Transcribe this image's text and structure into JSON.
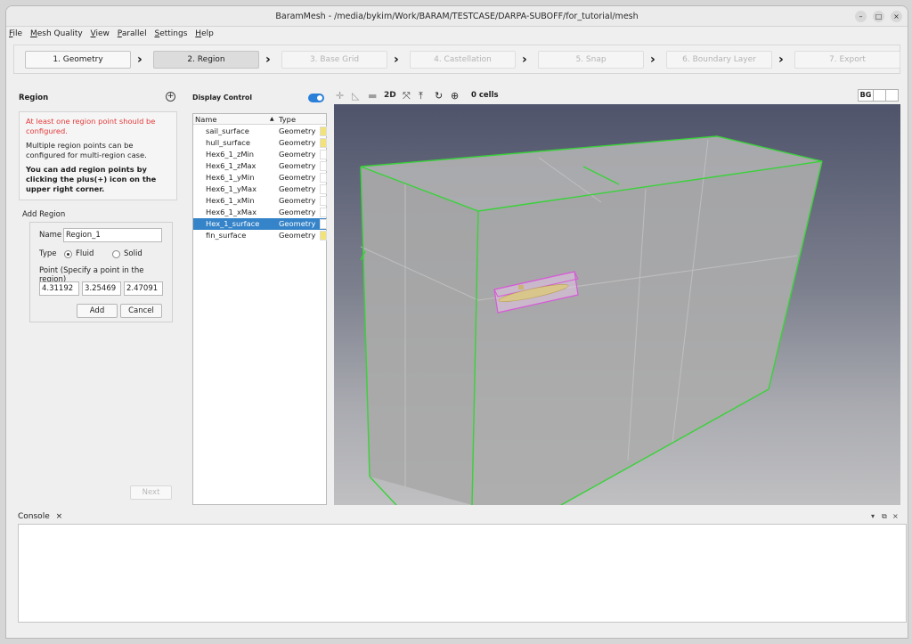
{
  "window": {
    "title": "BaramMesh - /media/bykim/Work/BARAM/TESTCASE/DARPA-SUBOFF/for_tutorial/mesh",
    "controls": [
      "–",
      "□",
      "×"
    ]
  },
  "menu": [
    "File",
    "Mesh Quality",
    "View",
    "Parallel",
    "Settings",
    "Help"
  ],
  "steps": [
    {
      "label": "1. Geometry",
      "state": "enabled"
    },
    {
      "label": "2. Region",
      "state": "active"
    },
    {
      "label": "3. Base Grid",
      "state": "disabled"
    },
    {
      "label": "4. Castellation",
      "state": "disabled"
    },
    {
      "label": "5. Snap",
      "state": "disabled"
    },
    {
      "label": "6. Boundary Layer",
      "state": "disabled"
    },
    {
      "label": "7. Export",
      "state": "disabled"
    }
  ],
  "region_panel": {
    "title": "Region",
    "add_icon": "plus-circle-icon",
    "error": "At least one region point should be configured.",
    "info": "Multiple region points can be configured for multi-region case.",
    "hint": "You can add region points by clicking the plus(+) icon on the upper right corner.",
    "add_region_label": "Add Region",
    "name_label": "Name",
    "name_value": "Region_1",
    "type_label": "Type",
    "type_options": [
      "Fluid",
      "Solid"
    ],
    "type_selected": "Fluid",
    "point_label": "Point (Specify a point in the region)",
    "point": [
      "4.31192",
      "3.25469",
      "2.47091"
    ],
    "add_button": "Add",
    "cancel_button": "Cancel",
    "next_button": "Next"
  },
  "display_control": {
    "title": "Display Control",
    "columns": [
      "Name",
      "Type"
    ],
    "rows": [
      {
        "name": "sail_surface",
        "type": "Geometry",
        "color": "#f2e27a"
      },
      {
        "name": "hull_surface",
        "type": "Geometry",
        "color": "#f2e27a"
      },
      {
        "name": "Hex6_1_zMin",
        "type": "Geometry",
        "color": "#ffffff"
      },
      {
        "name": "Hex6_1_zMax",
        "type": "Geometry",
        "color": "#ffffff"
      },
      {
        "name": "Hex6_1_yMin",
        "type": "Geometry",
        "color": "#ffffff"
      },
      {
        "name": "Hex6_1_yMax",
        "type": "Geometry",
        "color": "#ffffff"
      },
      {
        "name": "Hex6_1_xMin",
        "type": "Geometry",
        "color": "#ffffff"
      },
      {
        "name": "Hex6_1_xMax",
        "type": "Geometry",
        "color": "#ffffff"
      },
      {
        "name": "Hex_1_surface",
        "type": "Geometry",
        "color": "#ffffff",
        "selected": true
      },
      {
        "name": "fin_surface",
        "type": "Geometry",
        "color": "#f2e27a"
      }
    ]
  },
  "viewer": {
    "tools": [
      "axes-icon",
      "ruler-icon",
      "plane-icon",
      "2D",
      "fit-icon",
      "up-icon",
      "rotate-icon",
      "zoom-icon"
    ],
    "cells": "0 cells",
    "bg_label": "BG",
    "edge_color": "#39d239",
    "selection_color": "#d75ad7"
  },
  "console": {
    "tab": "Console",
    "close": "×",
    "controls": [
      "▾",
      "⧉",
      "×"
    ]
  }
}
